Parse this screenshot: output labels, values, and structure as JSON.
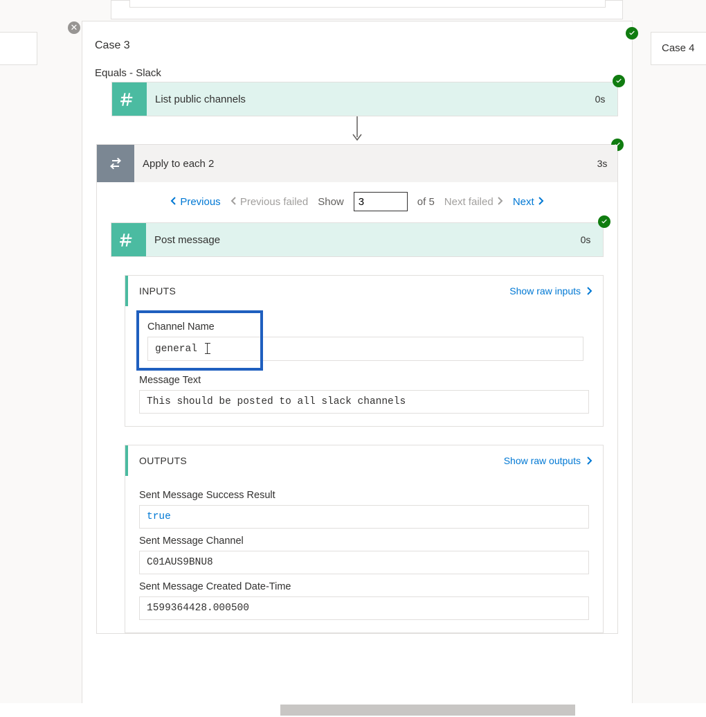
{
  "case3_label": "Case 3",
  "case4_label": "Case 4",
  "equals_label": "Equals - Slack",
  "steps": {
    "list_channels": {
      "title": "List public channels",
      "time": "0s"
    },
    "apply_each": {
      "title": "Apply to each 2",
      "time": "3s"
    },
    "post_message": {
      "title": "Post message",
      "time": "0s"
    }
  },
  "pager": {
    "previous": "Previous",
    "previous_failed": "Previous failed",
    "show": "Show",
    "current": "3",
    "of": "of 5",
    "next_failed": "Next failed",
    "next": "Next"
  },
  "inputs": {
    "header": "INPUTS",
    "raw": "Show raw inputs",
    "channel_name_label": "Channel Name",
    "channel_name_value": "general",
    "message_text_label": "Message Text",
    "message_text_value": "This should be posted to all slack channels"
  },
  "outputs": {
    "header": "OUTPUTS",
    "raw": "Show raw outputs",
    "success_label": "Sent Message Success Result",
    "success_value": "true",
    "channel_label": "Sent Message Channel",
    "channel_value": "C01AUS9BNU8",
    "datetime_label": "Sent Message Created Date-Time",
    "datetime_value": "1599364428.000500"
  },
  "close_glyph": "✕"
}
